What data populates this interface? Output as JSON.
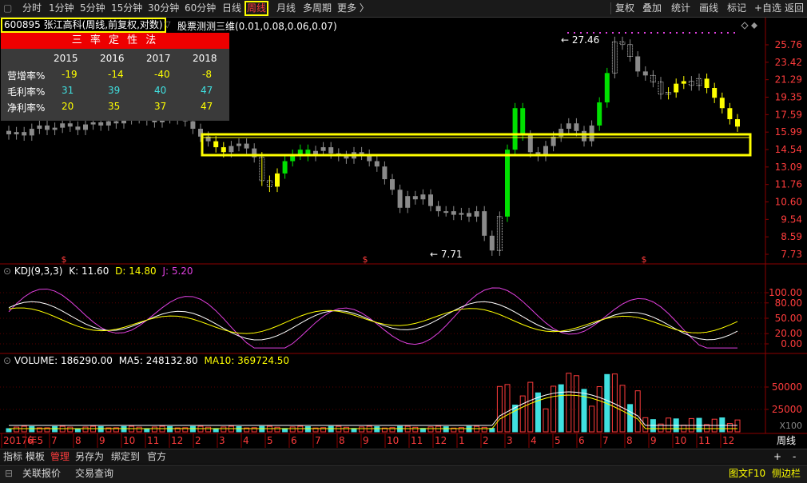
{
  "toolbar": {
    "period_tabs": [
      "分时",
      "1分钟",
      "5分钟",
      "15分钟",
      "30分钟",
      "60分钟",
      "日线",
      "周线",
      "月线",
      "多周期",
      "更多 〉"
    ],
    "active_tab": "周线",
    "right_buttons": [
      "复权",
      "叠加",
      "统计",
      "画线",
      "标记",
      "+自选",
      "返回"
    ]
  },
  "header": {
    "code_title": "600895 张江高科(周线,前复权,对数)",
    "indicator_title": "股票测测三维(0.01,0.08,0.06,0.07)"
  },
  "sanlv_panel": {
    "title": "三 率 定 性 法",
    "years": [
      "2015",
      "2016",
      "2017",
      "2018"
    ],
    "rows": [
      {
        "label": "营增率%",
        "values": [
          "-19",
          "-14",
          "-40",
          "-8"
        ],
        "color": "#ffff00"
      },
      {
        "label": "毛利率%",
        "values": [
          "31",
          "39",
          "40",
          "47"
        ],
        "color": "#40e0e0"
      },
      {
        "label": "净利率%",
        "values": [
          "20",
          "35",
          "37",
          "47"
        ],
        "color": "#ffff00"
      }
    ]
  },
  "price_axis": [
    "25.76",
    "23.42",
    "21.29",
    "19.35",
    "17.59",
    "15.99",
    "14.54",
    "13.09",
    "11.76",
    "10.60",
    "9.54",
    "8.59",
    "7.73"
  ],
  "price_labels": {
    "high": "27.46",
    "low": "7.71"
  },
  "kdj": {
    "title": "KDJ(9,3,3)",
    "k_text": "K: 11.60",
    "d_text": "D: 14.80",
    "j_text": "J: 5.20",
    "axis": [
      "100.00",
      "80.00",
      "50.00",
      "20.00",
      "0.00"
    ]
  },
  "volume": {
    "title": "VOLUME: 186290.00",
    "ma5_text": "MA5: 248132.80",
    "ma10_text": "MA10: 369724.50",
    "axis": [
      "50000",
      "25000"
    ],
    "unit": "X100"
  },
  "time_axis": {
    "labels": [
      "2017年5",
      "6",
      "7",
      "8",
      "9",
      "10",
      "11",
      "12",
      "2",
      "3",
      "4",
      "5",
      "6",
      "7",
      "8",
      "9",
      "10",
      "11",
      "12",
      "1",
      "2",
      "3",
      "4",
      "5",
      "6",
      "7",
      "8",
      "9",
      "10",
      "11",
      "12"
    ],
    "period_label": "周线"
  },
  "bottom_tabs": [
    "指标",
    "模板",
    "管理",
    "另存为",
    "绑定到",
    "官方"
  ],
  "bottom_active": "管理",
  "status": {
    "left_buttons": [
      "关联报价",
      "交易查询"
    ],
    "right_buttons": [
      "图文F10",
      "侧边栏"
    ]
  },
  "colors": {
    "up": "#ff3c3c",
    "down": "#00d000",
    "yellow": "#ffff00",
    "cyan": "#40e0e0",
    "magenta": "#e040e0",
    "gray": "#8a8a8a"
  }
}
